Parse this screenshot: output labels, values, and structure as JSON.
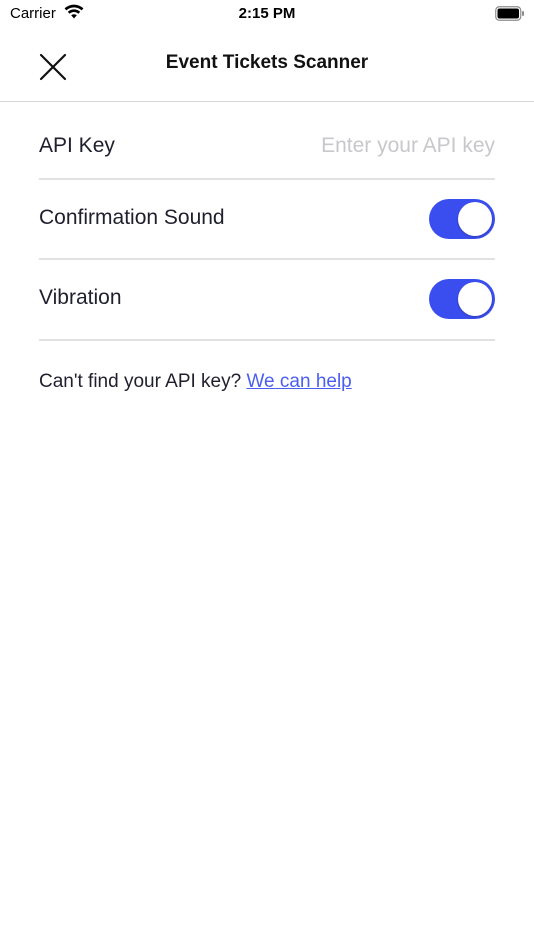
{
  "status_bar": {
    "carrier": "Carrier",
    "time": "2:15 PM",
    "icons": [
      "wifi-icon",
      "battery-icon"
    ]
  },
  "nav": {
    "title": "Event Tickets Scanner",
    "close_icon": "close-icon"
  },
  "settings": {
    "api_key": {
      "label": "API Key",
      "value": "",
      "placeholder": "Enter your API key"
    },
    "confirmation_sound": {
      "label": "Confirmation Sound",
      "enabled": true
    },
    "vibration": {
      "label": "Vibration",
      "enabled": true
    }
  },
  "help": {
    "text": "Can't find your API key? ",
    "link_label": "We can help"
  },
  "colors": {
    "accent": "#3a4ef0",
    "link": "#4a5ef2",
    "placeholder": "#c8c8cc",
    "divider": "#e1e1e4"
  }
}
